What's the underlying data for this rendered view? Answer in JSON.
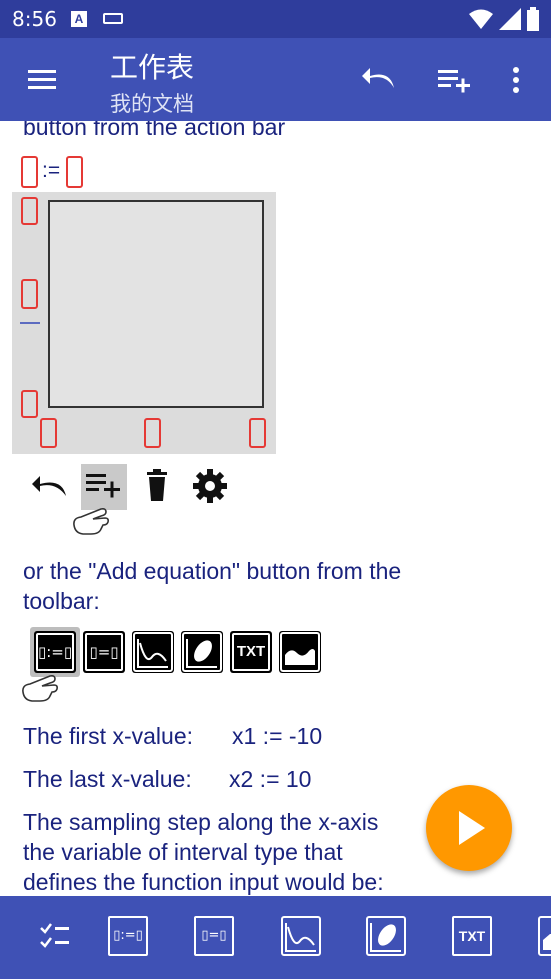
{
  "status": {
    "time": "8:56",
    "a_badge": "A"
  },
  "app_bar": {
    "title": "工作表",
    "subtitle": "我的文档"
  },
  "content": {
    "intro_tail": "button from the action bar",
    "assign_op": ":=",
    "or_text_1": "or the \"Add equation\" button from the",
    "or_text_2": "toolbar:",
    "first_x": {
      "label": "The first x-value:",
      "value": "x1 := -10"
    },
    "last_x": {
      "label": "The last x-value:",
      "value": "x2 := 10"
    },
    "sampling_1": "The sampling step along the x-axis",
    "sampling_2": "the variable of interval type that",
    "sampling_3": "defines the function input would be:"
  },
  "equation_buttons": [
    {
      "label": "▯:=▯",
      "selected": true
    },
    {
      "label": "▯=▯",
      "selected": false
    },
    {
      "label": "plot",
      "selected": false
    },
    {
      "label": "parametric",
      "selected": false
    },
    {
      "label": "TXT",
      "selected": false
    },
    {
      "label": "image",
      "selected": false
    }
  ],
  "bottom_bar": {
    "txt_label": "TXT",
    "eq1": "▯:=▯",
    "eq2": "▯=▯"
  },
  "colors": {
    "primary": "#3f51b5",
    "status": "#2f3d9c",
    "accent": "#ff9800",
    "text": "#1a237e",
    "placeholder": "#e53935"
  }
}
